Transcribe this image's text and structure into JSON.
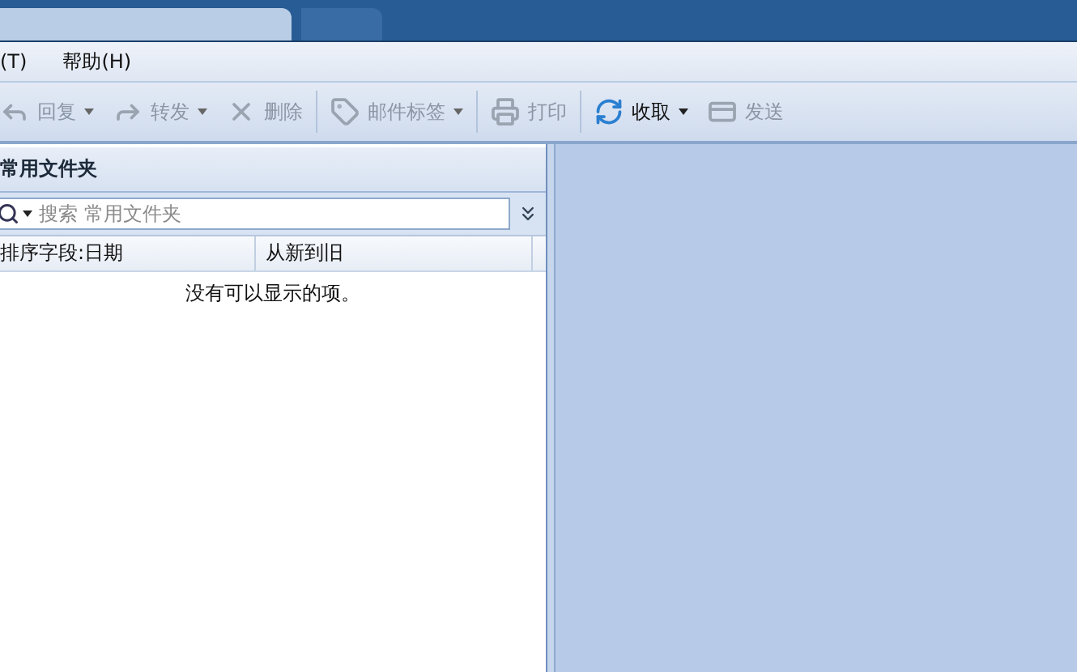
{
  "title_tabs": [
    {
      "selected": true
    },
    {
      "selected": false
    }
  ],
  "menu": [
    "(T)",
    "帮助(H)"
  ],
  "toolbar": [
    {
      "label": "回复",
      "disabled": true,
      "dropdown": true
    },
    {
      "label": "转发",
      "disabled": true,
      "dropdown": true
    },
    {
      "label": "删除",
      "disabled": true,
      "dropdown": false
    },
    {
      "label": "邮件标签",
      "disabled": true,
      "dropdown": true
    },
    {
      "label": "打印",
      "disabled": true,
      "dropdown": false
    },
    {
      "label": "收取",
      "disabled": false,
      "dropdown": true
    },
    {
      "label": "发送",
      "disabled": true,
      "dropdown": false
    }
  ],
  "folder_pane": {
    "title": "常用文件夹",
    "search": {
      "placeholder": "搜索 常用文件夹"
    },
    "sort_field": "排序字段:日期",
    "sort_order": "从新到旧",
    "empty_message": "没有可以显示的项。"
  }
}
